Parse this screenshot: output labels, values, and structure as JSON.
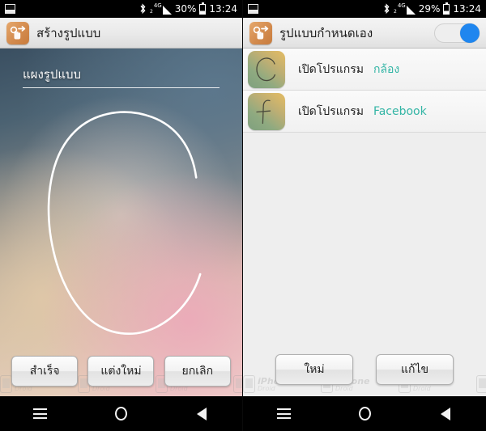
{
  "left_panel": {
    "statusbar": {
      "notification_icon": "photo-icon",
      "bluetooth_icon": "bluetooth-icon",
      "network_type": "4G",
      "signal_icon": "signal-bars-icon",
      "battery_percent": "30%",
      "battery_icon": "battery-icon",
      "time": "13:24"
    },
    "actionbar": {
      "app_icon": "gesture-hand-icon",
      "title": "สร้างรูปแบบ"
    },
    "name_field": {
      "value": "แผงรูปแบบ",
      "placeholder": "แผงรูปแบบ"
    },
    "gesture_canvas": {
      "drawn_glyph": "C"
    },
    "buttons": [
      {
        "label": "สำเร็จ",
        "name": "done-button"
      },
      {
        "label": "แต่งใหม่",
        "name": "retry-button"
      },
      {
        "label": "ยกเลิก",
        "name": "cancel-button"
      }
    ],
    "navbar": {
      "menu": "menu-icon",
      "home": "home-icon",
      "back": "back-icon"
    }
  },
  "right_panel": {
    "statusbar": {
      "notification_icon": "photo-icon",
      "bluetooth_icon": "bluetooth-icon",
      "network_type": "4G",
      "signal_icon": "signal-bars-icon",
      "battery_percent": "29%",
      "battery_icon": "battery-icon",
      "time": "13:24"
    },
    "actionbar": {
      "app_icon": "gesture-hand-icon",
      "title": "รูปแบบกำหนดเอง",
      "toggle": {
        "state": "on",
        "accent_color": "#1f86ef"
      }
    },
    "list": [
      {
        "thumbnail_glyph": "C",
        "action_label": "เปิดโปรแกรม",
        "target_value": "กล้อง",
        "value_color": "#33b5a5"
      },
      {
        "thumbnail_glyph": "f",
        "action_label": "เปิดโปรแกรม",
        "target_value": "Facebook",
        "value_color": "#33b5a5"
      }
    ],
    "buttons": [
      {
        "label": "ใหม่",
        "name": "new-button"
      },
      {
        "label": "แก้ไข",
        "name": "edit-button"
      }
    ],
    "navbar": {
      "menu": "menu-icon",
      "home": "home-icon",
      "back": "back-icon"
    }
  },
  "watermark": {
    "line1": "iPhone",
    "line2": "Droid"
  }
}
